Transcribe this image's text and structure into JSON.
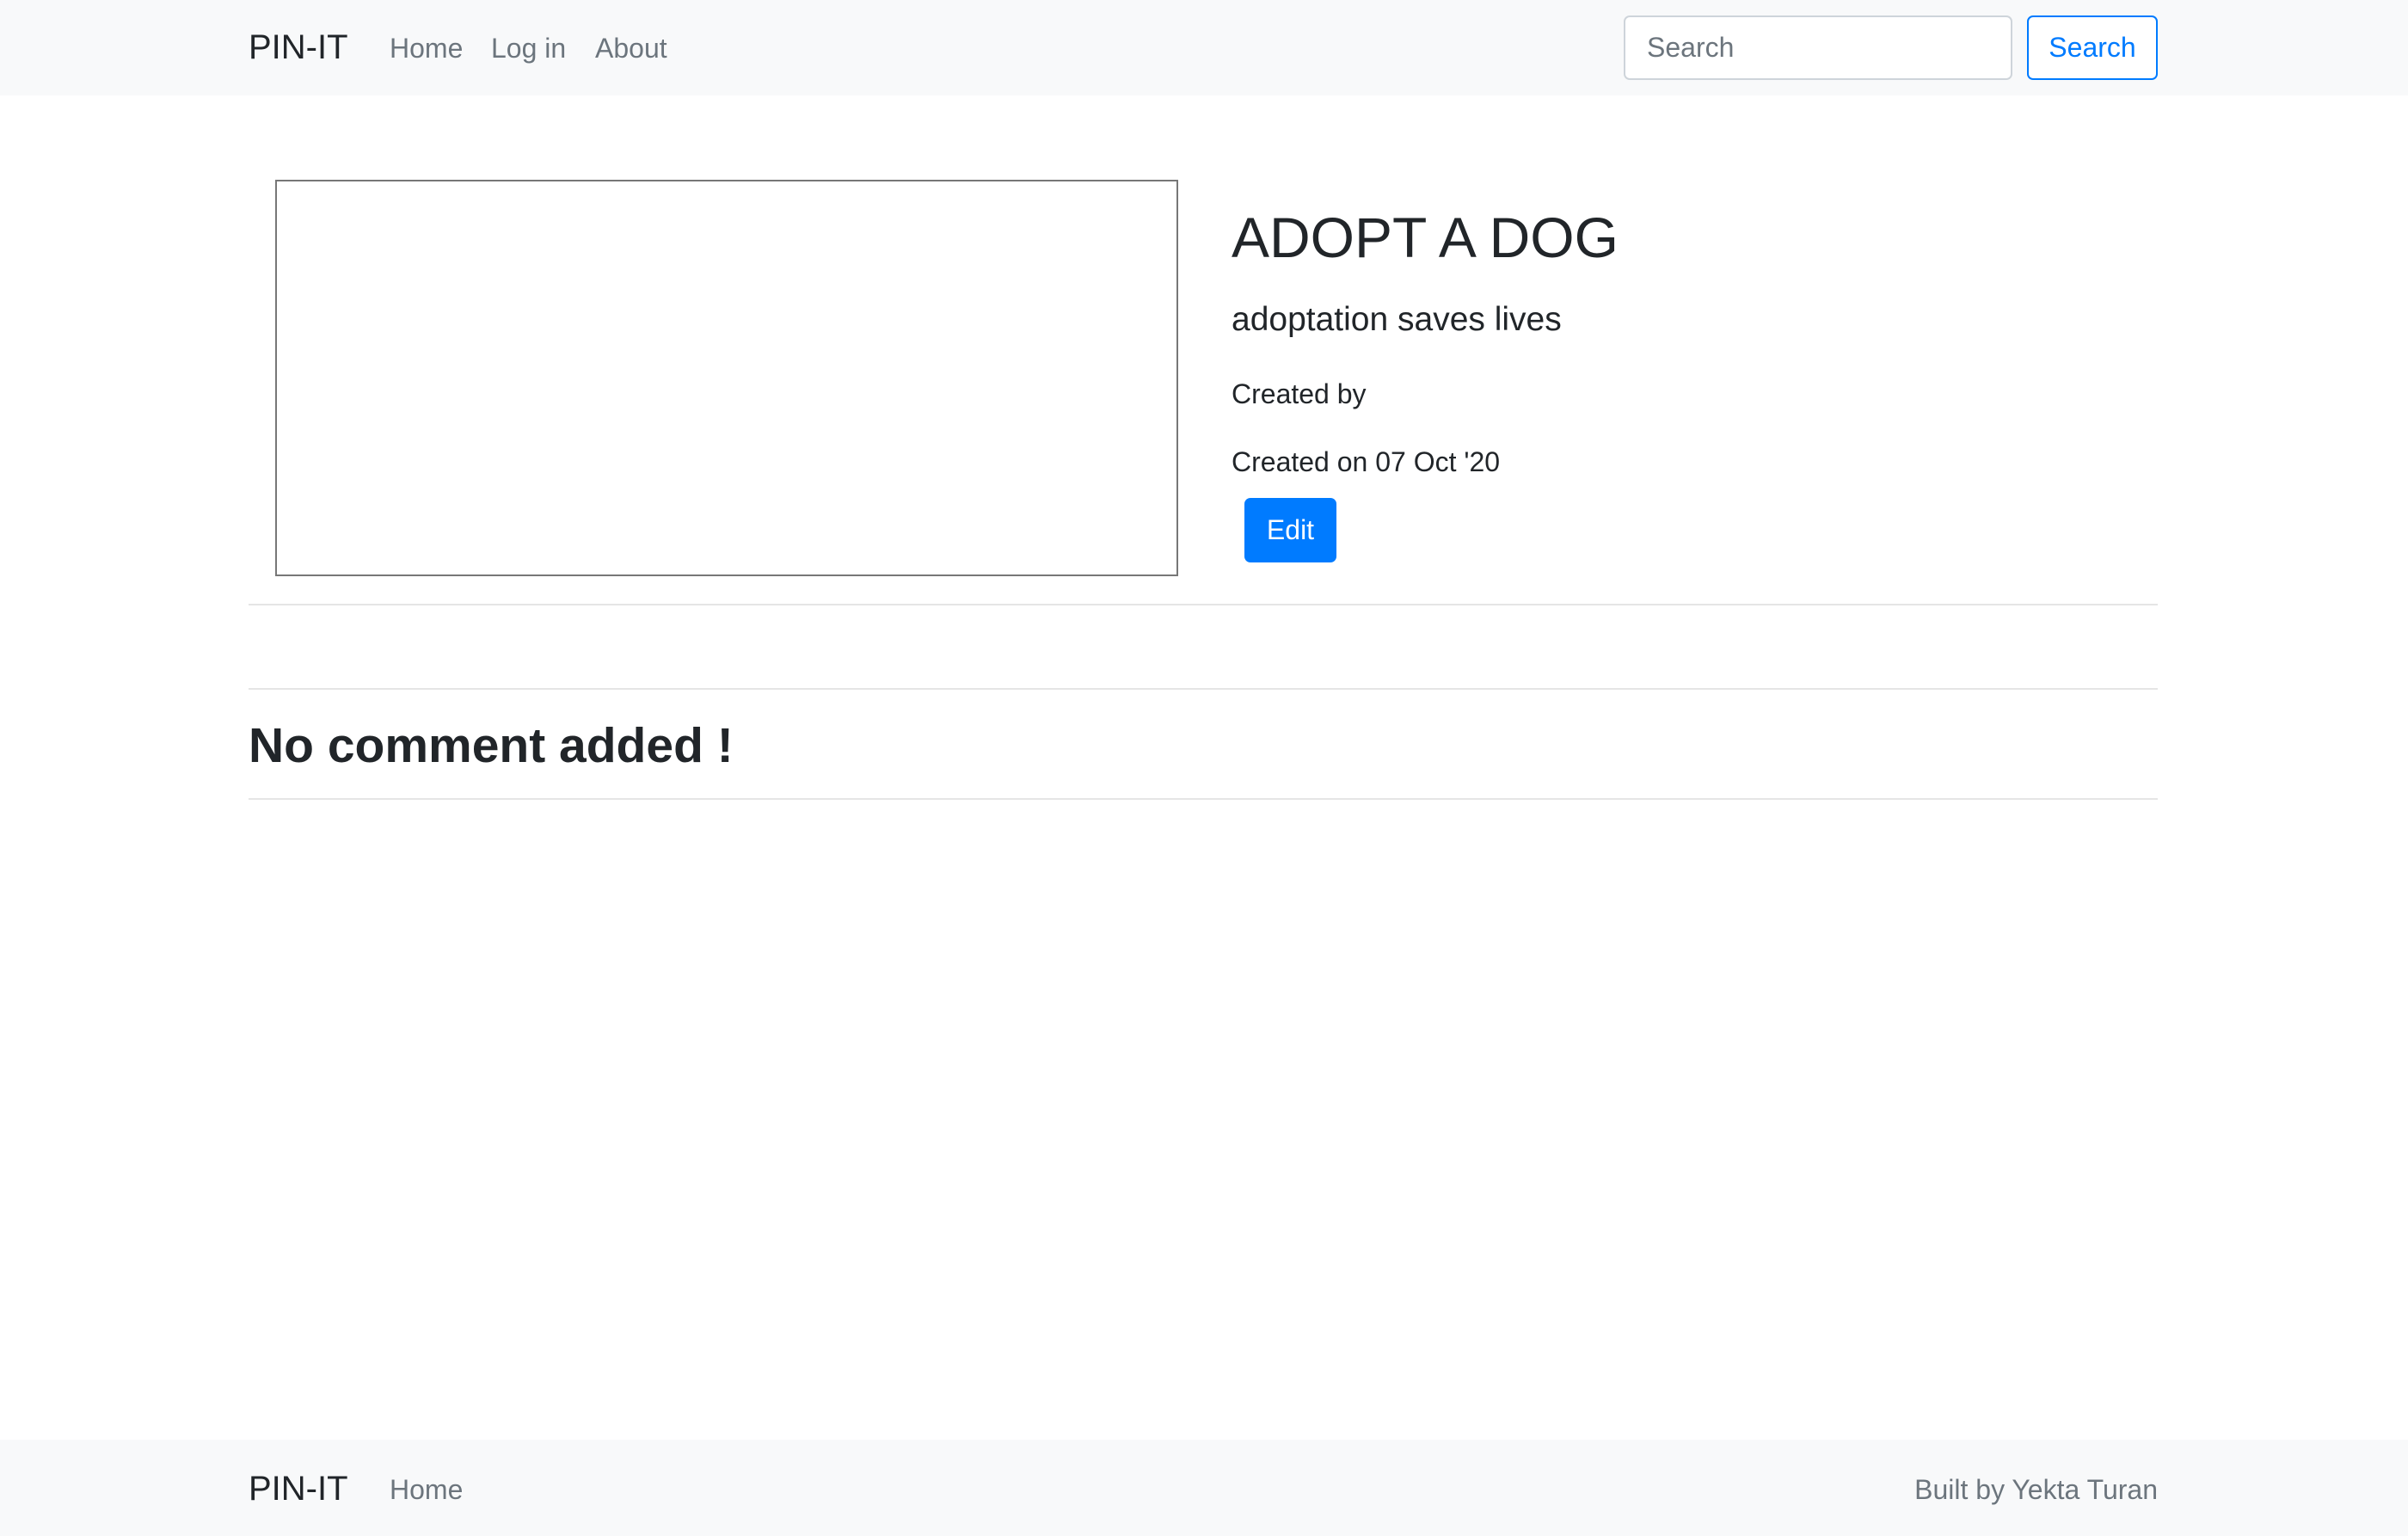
{
  "navbar": {
    "brand": "PIN-IT",
    "links": [
      "Home",
      "Log in",
      "About"
    ],
    "search_placeholder": "Search",
    "search_button": "Search"
  },
  "pin": {
    "title": "ADOPT A DOG",
    "description": "adoptation saves lives",
    "created_by": "Created by",
    "created_on": "Created on 07 Oct '20",
    "edit_label": "Edit"
  },
  "comments": {
    "empty_message": "No comment added !"
  },
  "footer": {
    "brand": "PIN-IT",
    "home": "Home",
    "credit": "Built by Yekta Turan"
  },
  "colors": {
    "primary": "#007bff",
    "bar_bg": "#f8f9fa"
  }
}
